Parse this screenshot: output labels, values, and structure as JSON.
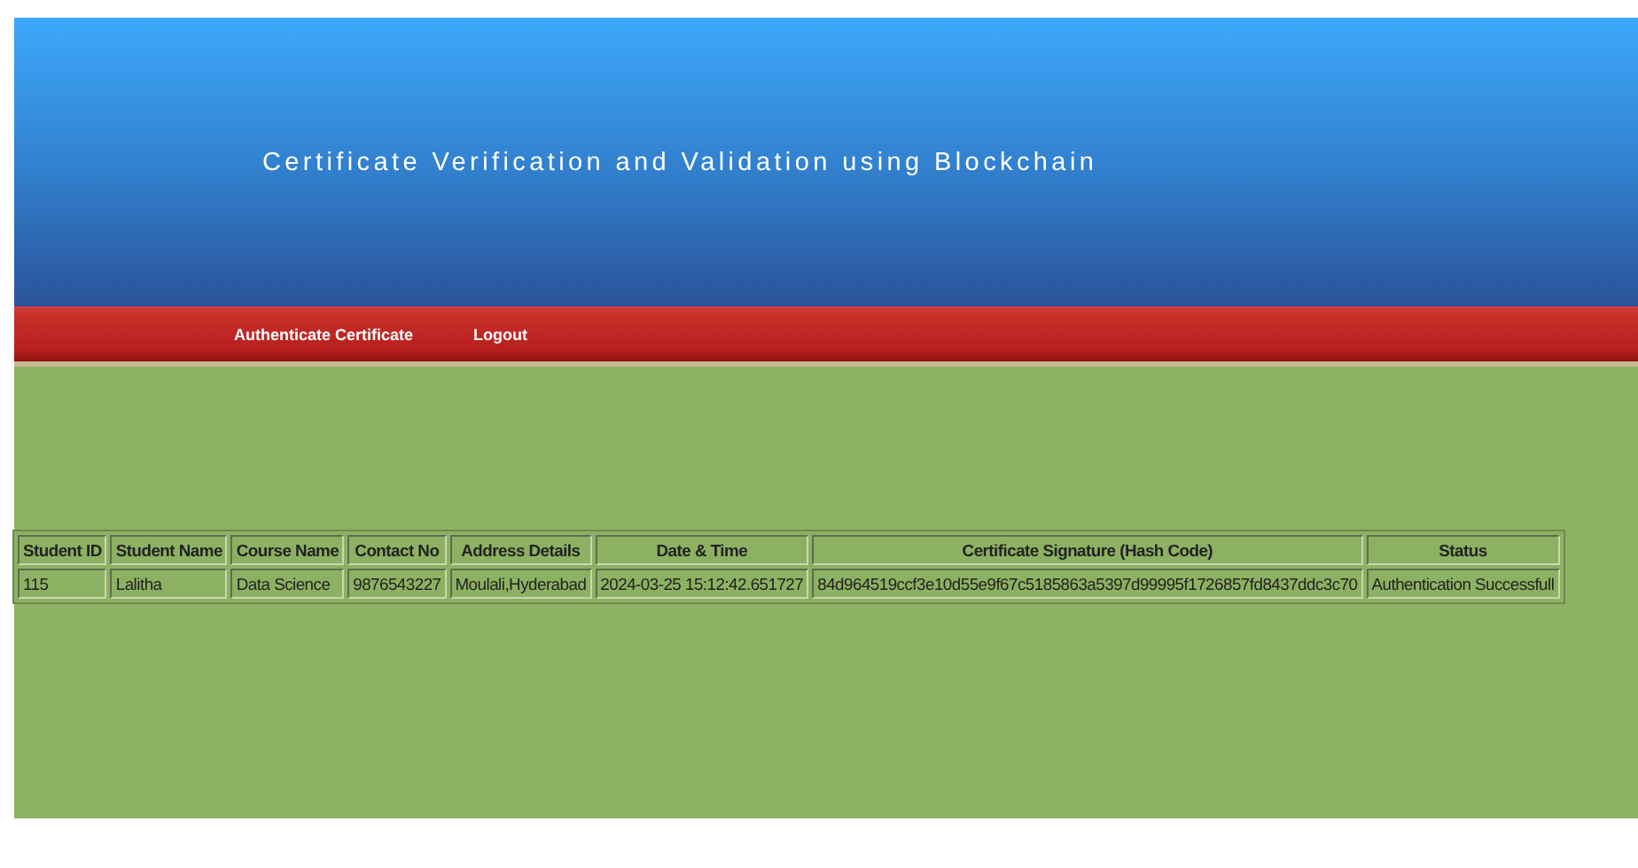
{
  "header": {
    "title": "Certificate Verification and Validation using Blockchain"
  },
  "nav": [
    {
      "label": "Authenticate Certificate"
    },
    {
      "label": "Logout"
    }
  ],
  "table": {
    "columns": [
      "Student ID",
      "Student Name",
      "Course Name",
      "Contact No",
      "Address Details",
      "Date & Time",
      "Certificate Signature (Hash Code)",
      "Status"
    ],
    "rows": [
      [
        "115",
        "Lalitha",
        "Data Science",
        "9876543227",
        "Moulali,Hyderabad",
        "2024-03-25 15:12:42.651727",
        "84d964519ccf3e10d55e9f67c5185863a5397d99995f1726857fd8437ddc3c70",
        "Authentication Successfull"
      ]
    ]
  }
}
